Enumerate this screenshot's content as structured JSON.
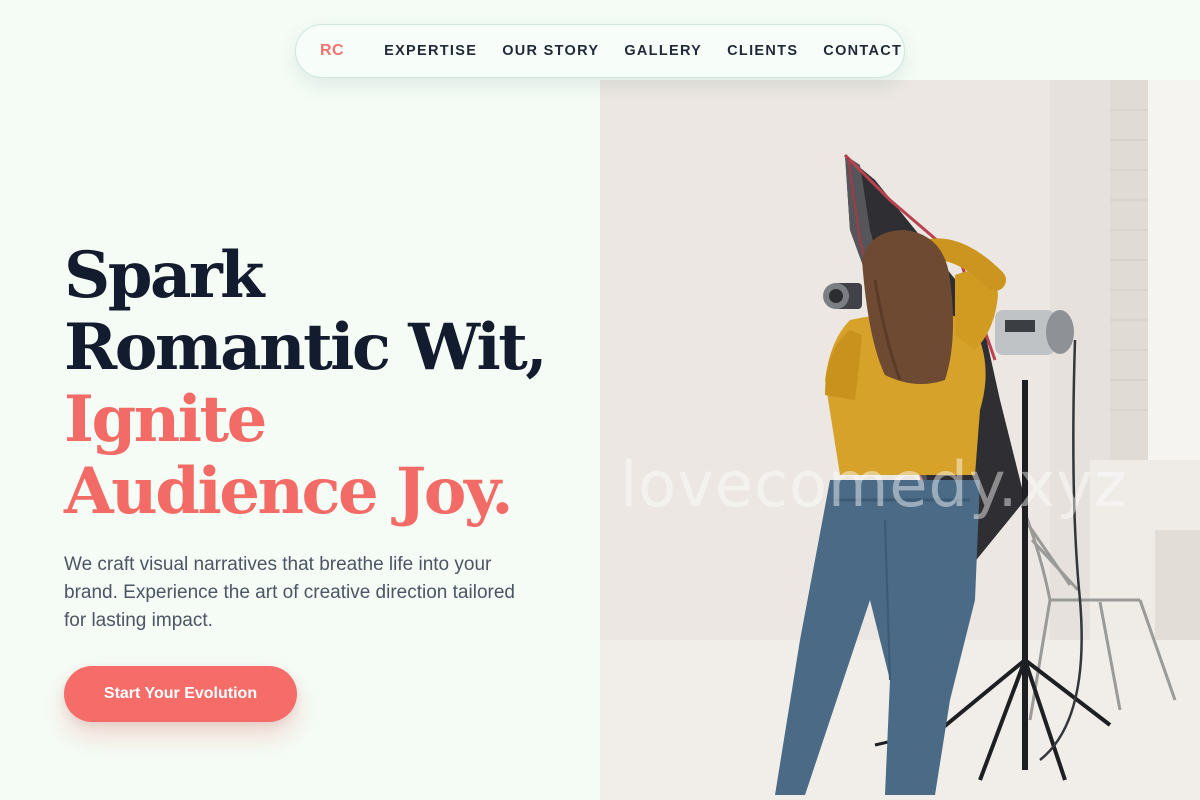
{
  "nav": {
    "logo": "RC",
    "links": [
      "EXPERTISE",
      "OUR STORY",
      "GALLERY",
      "CLIENTS",
      "CONTACT"
    ]
  },
  "hero": {
    "title_line1": "Spark",
    "title_line2": "Romantic Wit,",
    "title_line3": "Ignite",
    "title_line4": "Audience Joy.",
    "description": "We craft visual narratives that breathe life into your brand. Experience the art of creative direction tailored for lasting impact.",
    "cta_label": "Start Your Evolution"
  },
  "image": {
    "subject": "photographer-with-studio-light",
    "watermark": "lovecomedy.xyz"
  },
  "colors": {
    "accent": "#f26b66",
    "background": "#f5fcf6",
    "heading": "#131b2e"
  }
}
